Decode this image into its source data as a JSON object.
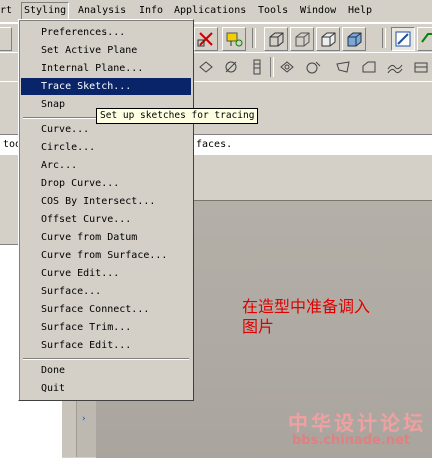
{
  "menubar": {
    "items": [
      {
        "label": "rt"
      },
      {
        "label": "Styling"
      },
      {
        "label": "Analysis"
      },
      {
        "label": "Info"
      },
      {
        "label": "Applications"
      },
      {
        "label": "Tools"
      },
      {
        "label": "Window"
      },
      {
        "label": "Help"
      }
    ]
  },
  "styling_menu": {
    "items": [
      {
        "label": "Preferences..."
      },
      {
        "label": "Set Active Plane"
      },
      {
        "label": "Internal Plane..."
      },
      {
        "label": "Trace Sketch..."
      },
      {
        "label": "Snap"
      },
      {
        "label": "Curve..."
      },
      {
        "label": "Circle..."
      },
      {
        "label": "Arc..."
      },
      {
        "label": "Drop Curve..."
      },
      {
        "label": "COS By Intersect..."
      },
      {
        "label": "Offset Curve..."
      },
      {
        "label": "Curve from Datum"
      },
      {
        "label": "Curve from Surface..."
      },
      {
        "label": "Curve Edit..."
      },
      {
        "label": "Surface..."
      },
      {
        "label": "Surface Connect..."
      },
      {
        "label": "Surface Trim..."
      },
      {
        "label": "Surface Edit..."
      },
      {
        "label": "Done"
      },
      {
        "label": "Quit"
      }
    ],
    "selected": "Trace Sketch..."
  },
  "tooltip": "Set up sketches for tracing",
  "message_line": {
    "left_fragment": "too",
    "right_fragment": "faces."
  },
  "annotation": {
    "line1": "在造型中准备调入",
    "line2": "图片"
  },
  "watermark": {
    "title": "中华设计论坛",
    "url": "bbs.chinade.net"
  },
  "colors": {
    "menu_highlight": "#0a246a",
    "annotation_red": "#e00000",
    "tooltip_bg": "#ffffe1"
  }
}
